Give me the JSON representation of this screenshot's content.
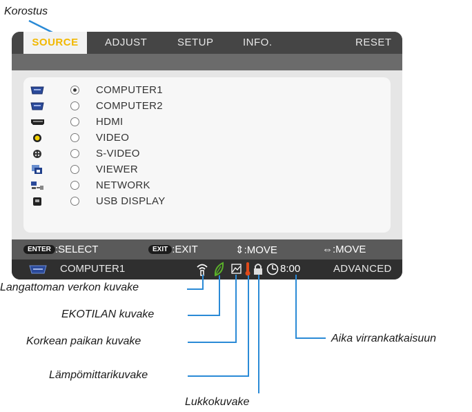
{
  "callouts": {
    "highlight": "Korostus",
    "wireless": "Langattoman verkon kuvake",
    "eco": "EKOTILAN kuvake",
    "altitude": "Korkean paikan kuvake",
    "thermometer": "Lämpömittarikuvake",
    "lock": "Lukkokuvake",
    "off_timer": "Aika virrankatkaisuun"
  },
  "menu": {
    "tabs": [
      {
        "label": "SOURCE",
        "active": true
      },
      {
        "label": "ADJUST",
        "active": false
      },
      {
        "label": "SETUP",
        "active": false
      },
      {
        "label": "INFO.",
        "active": false
      },
      {
        "label": "RESET",
        "active": false
      }
    ],
    "sources": [
      {
        "label": "COMPUTER1",
        "icon": "vga-connector-icon",
        "selected": true
      },
      {
        "label": "COMPUTER2",
        "icon": "vga-connector-icon",
        "selected": false
      },
      {
        "label": "HDMI",
        "icon": "hdmi-connector-icon",
        "selected": false
      },
      {
        "label": "VIDEO",
        "icon": "rca-video-icon",
        "selected": false
      },
      {
        "label": "S-VIDEO",
        "icon": "svideo-connector-icon",
        "selected": false
      },
      {
        "label": "VIEWER",
        "icon": "viewer-icon",
        "selected": false
      },
      {
        "label": "NETWORK",
        "icon": "network-icon",
        "selected": false
      },
      {
        "label": "USB DISPLAY",
        "icon": "usb-display-icon",
        "selected": false
      }
    ]
  },
  "help": {
    "enter_key": "ENTER",
    "select": ":SELECT",
    "exit_key": "EXIT",
    "exit": ":EXIT",
    "move_vertical": "⇕:MOVE",
    "move_horizontal": "⇔:MOVE"
  },
  "status": {
    "source": "COMPUTER1",
    "time": "8:00",
    "mode": "ADVANCED"
  },
  "colors": {
    "accent": "#f2b800",
    "callout_line": "#2a8ad6",
    "thermometer": "#e04a1a",
    "eco": "#5ab02a"
  }
}
